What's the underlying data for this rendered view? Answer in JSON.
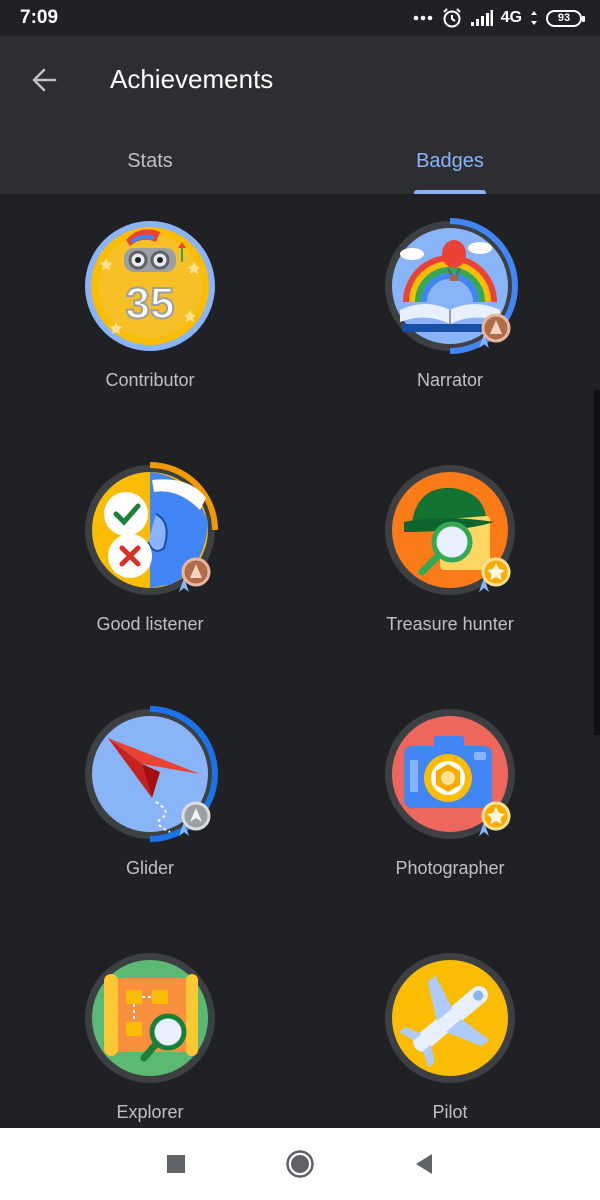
{
  "status_bar": {
    "time": "7:09",
    "network": "4G",
    "battery": "93",
    "icons": [
      "more-dots-icon",
      "alarm-icon",
      "signal-icon",
      "battery-icon"
    ]
  },
  "app_bar": {
    "title": "Achievements",
    "back_icon": "arrow-back-icon"
  },
  "tabs": [
    {
      "label": "Stats",
      "active": false
    },
    {
      "label": "Badges",
      "active": true
    }
  ],
  "badges": [
    {
      "label": "Contributor",
      "number": "35",
      "medal": null
    },
    {
      "label": "Narrator",
      "medal": "bronze"
    },
    {
      "label": "Good listener",
      "medal": "bronze"
    },
    {
      "label": "Treasure hunter",
      "medal": "gold"
    },
    {
      "label": "Glider",
      "medal": "silver"
    },
    {
      "label": "Photographer",
      "medal": "gold"
    },
    {
      "label": "Explorer",
      "medal": null
    },
    {
      "label": "Pilot",
      "medal": null
    }
  ],
  "colors": {
    "background": "#202124",
    "app_bar": "#2d2e31",
    "accent": "#8ab4f8",
    "label": "#bdc1c6",
    "ring_track": "#3c4043",
    "progress_blue": "#4285f4",
    "progress_orange": "#f29900"
  },
  "nav_bar": {
    "icons": [
      "recents-square-icon",
      "home-circle-icon",
      "back-triangle-icon"
    ]
  }
}
